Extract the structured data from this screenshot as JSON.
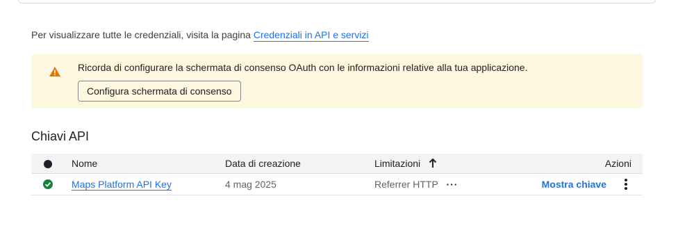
{
  "credentials_note": {
    "text": "Per visualizzare tutte le credenziali, visita la pagina",
    "link": "Credenziali in API e servizi"
  },
  "oauth_banner": {
    "message": "Ricorda di configurare la schermata di consenso OAuth con le informazioni relative alla tua applicazione.",
    "button_label": "Configura schermata di consenso",
    "icon": "warning-icon",
    "background_color": "#fef7e0",
    "icon_color": "#e37400"
  },
  "api_keys": {
    "title": "Chiavi API",
    "columns": {
      "name": "Nome",
      "created": "Data di creazione",
      "restrictions": "Limitazioni",
      "actions": "Azioni"
    },
    "rows": [
      {
        "status_icon": "check-circle-icon",
        "status_color": "#188038",
        "name": "Maps Platform API Key",
        "created": "4 mag 2025",
        "restriction": "Referrer HTTP",
        "more_label": "···",
        "action_label": "Mostra chiave"
      }
    ]
  }
}
